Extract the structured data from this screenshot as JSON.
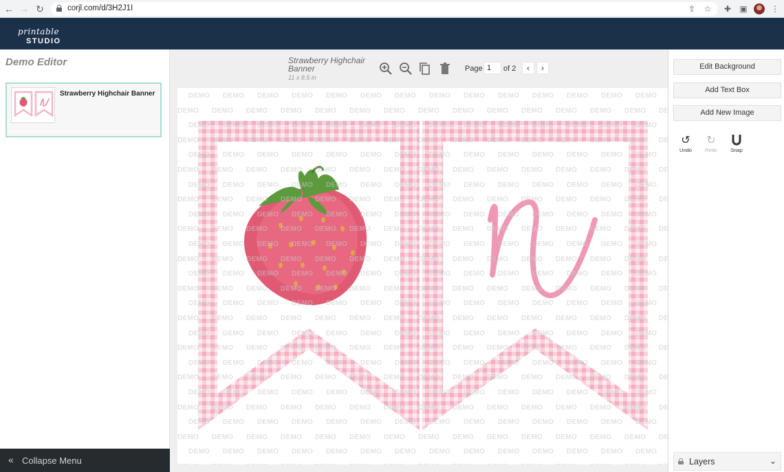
{
  "browser": {
    "url": "corjl.com/d/3H2J1I",
    "icons": [
      "back-arrow-icon",
      "forward-arrow-icon",
      "reload-icon",
      "lock-icon",
      "share-icon",
      "bookmark-star-icon",
      "extensions-puzzle-icon",
      "side-panel-icon",
      "profile-avatar",
      "more-menu-icon"
    ]
  },
  "header": {
    "logo_script": "printable",
    "logo_studio": "STUDIO"
  },
  "sidebar": {
    "title": "Demo Editor",
    "design_card": {
      "title": "Strawberry Highchair Banner"
    },
    "collapse_label": "Collapse Menu"
  },
  "toolbar": {
    "doc_title": "Strawberry Highchair Banner",
    "doc_size": "11 x 8.5 in",
    "page_label": "Page",
    "page_value": "1",
    "page_total": "of 2",
    "tools": [
      "zoom-in-icon",
      "zoom-out-icon",
      "duplicate-icon",
      "trash-icon"
    ]
  },
  "canvas": {
    "watermark_text": "DEMO",
    "letter": "n",
    "colors": {
      "gingham": "#f4b6c6",
      "strawberry": "#e05a73",
      "leaf": "#5c9a3d",
      "letter": "#ee98b6"
    }
  },
  "right_panel": {
    "edit_background": "Edit Background",
    "add_text_box": "Add Text Box",
    "add_new_image": "Add New Image",
    "undo": "Undo",
    "redo": "Redo",
    "snap": "Snap",
    "layers": "Layers"
  }
}
